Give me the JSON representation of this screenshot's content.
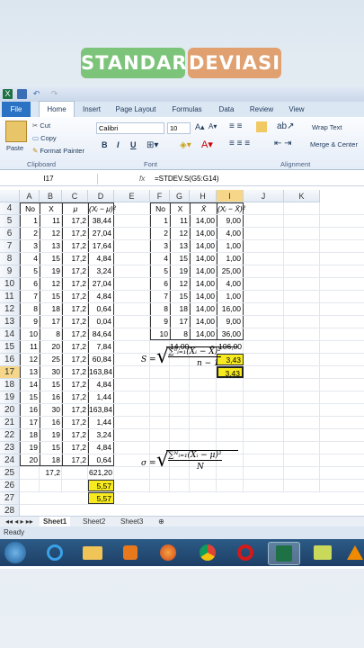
{
  "title": {
    "word1": "STANDAR",
    "word2": "DEVIASI"
  },
  "ribbon": {
    "tabs": [
      "File",
      "Home",
      "Insert",
      "Page Layout",
      "Formulas",
      "Data",
      "Review",
      "View"
    ],
    "cut": "Cut",
    "copy": "Copy",
    "paste": "Paste",
    "format_painter": "Format Painter",
    "font_name": "Calibri",
    "font_size": "10",
    "bold": "B",
    "italic": "I",
    "underline": "U",
    "wrap_text": "Wrap Text",
    "merge": "Merge & Center",
    "groups": {
      "clipboard": "Clipboard",
      "font": "Font",
      "alignment": "Alignment"
    }
  },
  "formula_bar": {
    "name_box": "I17",
    "fx": "fx",
    "formula": "=STDEV.S(G5:G14)"
  },
  "columns": [
    "A",
    "B",
    "C",
    "D",
    "E",
    "F",
    "G",
    "H",
    "I",
    "J",
    "K"
  ],
  "rows": [
    "4",
    "5",
    "6",
    "7",
    "8",
    "9",
    "10",
    "11",
    "12",
    "13",
    "14",
    "15",
    "16",
    "17",
    "18",
    "19",
    "20",
    "21",
    "22",
    "23",
    "24",
    "25",
    "26",
    "27",
    "28"
  ],
  "table1": {
    "headers": {
      "no": "No",
      "x": "X",
      "mu": "μ",
      "dev": "(Xᵢ − μ)²"
    },
    "rows": [
      [
        "1",
        "11",
        "17,2",
        "38,44"
      ],
      [
        "2",
        "12",
        "17,2",
        "27,04"
      ],
      [
        "3",
        "13",
        "17,2",
        "17,64"
      ],
      [
        "4",
        "15",
        "17,2",
        "4,84"
      ],
      [
        "5",
        "19",
        "17,2",
        "3,24"
      ],
      [
        "6",
        "12",
        "17,2",
        "27,04"
      ],
      [
        "7",
        "15",
        "17,2",
        "4,84"
      ],
      [
        "8",
        "18",
        "17,2",
        "0,64"
      ],
      [
        "9",
        "17",
        "17,2",
        "0,04"
      ],
      [
        "10",
        "8",
        "17,2",
        "84,64"
      ],
      [
        "11",
        "20",
        "17,2",
        "7,84"
      ],
      [
        "12",
        "25",
        "17,2",
        "60,84"
      ],
      [
        "13",
        "30",
        "17,2",
        "163,84"
      ],
      [
        "14",
        "15",
        "17,2",
        "4,84"
      ],
      [
        "15",
        "16",
        "17,2",
        "1,44"
      ],
      [
        "16",
        "30",
        "17,2",
        "163,84"
      ],
      [
        "17",
        "16",
        "17,2",
        "1,44"
      ],
      [
        "18",
        "19",
        "17,2",
        "3,24"
      ],
      [
        "19",
        "15",
        "17,2",
        "4,84"
      ],
      [
        "20",
        "18",
        "17,2",
        "0,64"
      ]
    ],
    "mean": "17,2",
    "sum": "621,20",
    "pop_sd_1": "5,57",
    "pop_sd_2": "5,57"
  },
  "table2": {
    "headers": {
      "no": "No",
      "x": "X",
      "xbar": "X̄",
      "dev": "(Xᵢ − X̄)²"
    },
    "rows": [
      [
        "1",
        "11",
        "14,00",
        "9,00"
      ],
      [
        "2",
        "12",
        "14,00",
        "4,00"
      ],
      [
        "3",
        "13",
        "14,00",
        "1,00"
      ],
      [
        "4",
        "15",
        "14,00",
        "1,00"
      ],
      [
        "5",
        "19",
        "14,00",
        "25,00"
      ],
      [
        "6",
        "12",
        "14,00",
        "4,00"
      ],
      [
        "7",
        "15",
        "14,00",
        "1,00"
      ],
      [
        "8",
        "18",
        "14,00",
        "16,00"
      ],
      [
        "9",
        "17",
        "14,00",
        "9,00"
      ],
      [
        "10",
        "8",
        "14,00",
        "36,00"
      ]
    ],
    "mean": "14,00",
    "sum": "106,00",
    "sample_sd_1": "3,43",
    "sample_sd_2": "3,43"
  },
  "formulas": {
    "sample": {
      "lhs": "S =",
      "num": "∑ⁿᵢ₌₁(Xᵢ − X̄)²",
      "den": "n − 1"
    },
    "population": {
      "lhs": "σ =",
      "num": "∑ᴺᵢ₌₁(Xᵢ − μ)²",
      "den": "N"
    }
  },
  "sheets": [
    "Sheet1",
    "Sheet2",
    "Sheet3"
  ],
  "status": "Ready",
  "colors": {
    "accent": "#2a72c4",
    "highlight": "#f7ea1e",
    "title_green": "#7cc47a",
    "title_orange": "#e0a070"
  }
}
